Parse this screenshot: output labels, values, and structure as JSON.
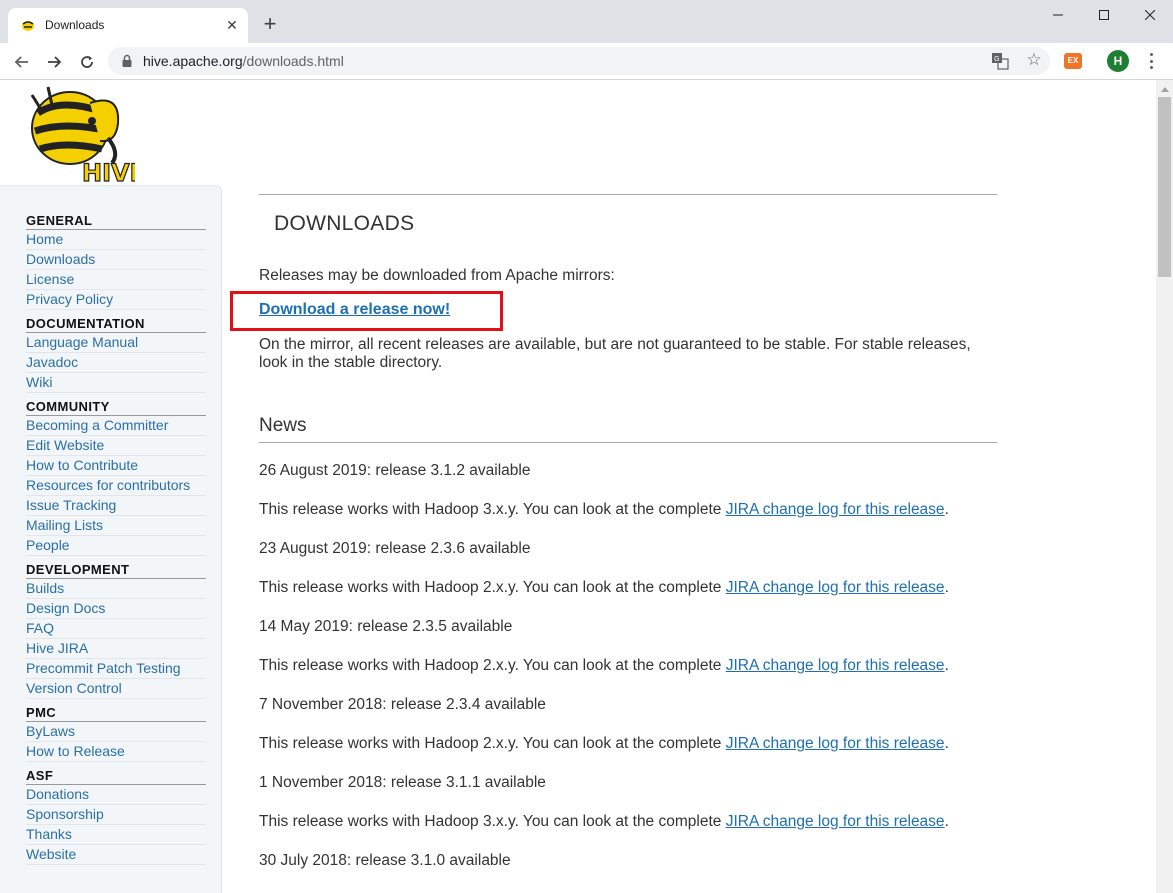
{
  "browser": {
    "tab_title": "Downloads",
    "url_host": "hive.apache.org",
    "url_path": "/downloads.html",
    "new_tab_label": "+",
    "profile_initial": "H",
    "extension_label": "EX"
  },
  "sidebar": {
    "sections": [
      {
        "heading": "GENERAL",
        "links": [
          "Home",
          "Downloads",
          "License",
          "Privacy Policy"
        ]
      },
      {
        "heading": "DOCUMENTATION",
        "links": [
          "Language Manual",
          "Javadoc",
          "Wiki"
        ]
      },
      {
        "heading": "COMMUNITY",
        "links": [
          "Becoming a Committer",
          "Edit Website",
          "How to Contribute",
          "Resources for contributors",
          "Issue Tracking",
          "Mailing Lists",
          "People"
        ]
      },
      {
        "heading": "DEVELOPMENT",
        "links": [
          "Builds",
          "Design Docs",
          "FAQ",
          "Hive JIRA",
          "Precommit Patch Testing",
          "Version Control"
        ]
      },
      {
        "heading": "PMC",
        "links": [
          "ByLaws",
          "How to Release"
        ]
      },
      {
        "heading": "ASF",
        "links": [
          "Donations",
          "Sponsorship",
          "Thanks",
          "Website"
        ]
      }
    ]
  },
  "main": {
    "title": "DOWNLOADS",
    "mirrors_text": "Releases may be downloaded from Apache mirrors:",
    "download_link": "Download a release now!",
    "mirror_note": "On the mirror, all recent releases are available, but are not guaranteed to be stable. For stable releases, look in the stable directory.",
    "news_title": "News",
    "news": [
      {
        "date": "26 August 2019: release 3.1.2 available",
        "desc": "This release works with Hadoop 3.x.y. You can look at the complete ",
        "link": "JIRA change log for this release",
        "suffix": "."
      },
      {
        "date": "23 August 2019: release 2.3.6 available",
        "desc": "This release works with Hadoop 2.x.y. You can look at the complete ",
        "link": "JIRA change log for this release",
        "suffix": "."
      },
      {
        "date": "14 May 2019: release 2.3.5 available",
        "desc": "This release works with Hadoop 2.x.y. You can look at the complete ",
        "link": "JIRA change log for this release",
        "suffix": "."
      },
      {
        "date": "7 November 2018: release 2.3.4 available",
        "desc": "This release works with Hadoop 2.x.y. You can look at the complete ",
        "link": "JIRA change log for this release",
        "suffix": "."
      },
      {
        "date": "1 November 2018: release 3.1.1 available",
        "desc": "This release works with Hadoop 3.x.y. You can look at the complete ",
        "link": "JIRA change log for this release",
        "suffix": "."
      },
      {
        "date": "30 July 2018: release 3.1.0 available",
        "desc": "",
        "link": "",
        "suffix": ""
      }
    ]
  },
  "colors": {
    "link": "#1e6fb3",
    "highlight_border": "#e0101a",
    "sidebar_bg": "#f3f6f8"
  }
}
